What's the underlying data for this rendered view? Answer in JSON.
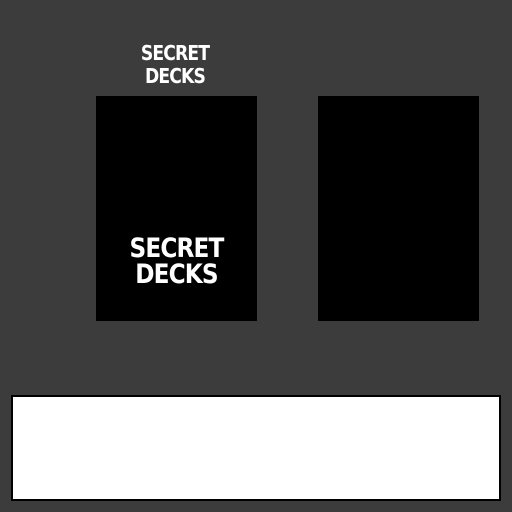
{
  "title": {
    "line1": "SECRET",
    "line2": "DECKS"
  },
  "cards": [
    {
      "label_line1": "SECRET",
      "label_line2": "DECKS"
    },
    {}
  ],
  "colors": {
    "background": "#3c3c3c",
    "card_back": "#000000",
    "text": "#ffffff",
    "message_box": "#ffffff"
  }
}
